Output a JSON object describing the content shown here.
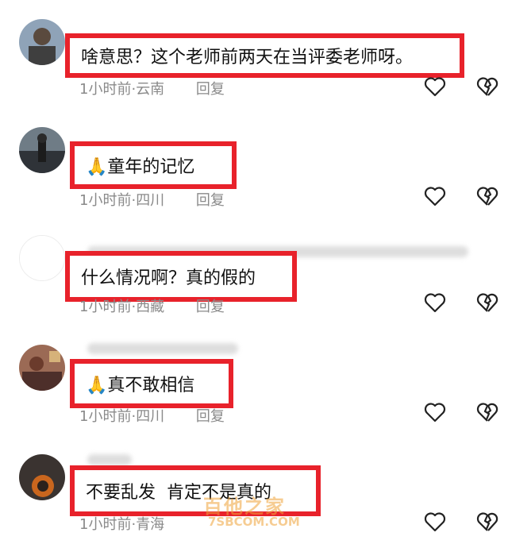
{
  "colors": {
    "highlight": "#e8222b",
    "meta_text": "#8a8a8a",
    "watermark": "#f0a43a"
  },
  "comments": [
    {
      "text": "啥意思？这个老师前两天在当评委老师呀。",
      "time": "1小时前",
      "location": "云南",
      "reply": "回复"
    },
    {
      "emoji": "🙏",
      "text": "童年的记忆",
      "time": "1小时前",
      "location": "四川",
      "reply": "回复"
    },
    {
      "text": "什么情况啊？真的假的",
      "time": "1小时前",
      "location": "西藏",
      "reply": "回复"
    },
    {
      "emoji": "🙏",
      "text": "真不敢相信",
      "time": "1小时前",
      "location": "四川",
      "reply": "回复"
    },
    {
      "text": "不要乱发  肯定不是真的",
      "time": "1小时前",
      "location": "青海",
      "reply": "回复"
    }
  ],
  "icons": {
    "like": "heart-outline-icon",
    "dislike": "broken-heart-icon"
  },
  "watermark": {
    "title": "百他之家",
    "url": "7SBCOM.COM"
  }
}
